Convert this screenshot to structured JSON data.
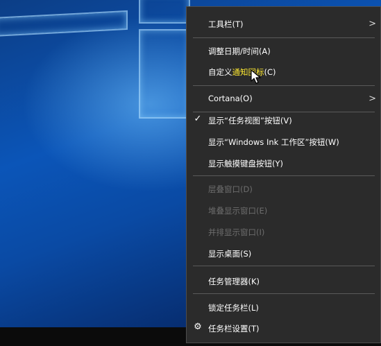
{
  "context_menu": {
    "items": [
      {
        "label": "工具栏(T)",
        "submenu": true
      },
      {
        "label": "调整日期/时间(A)"
      },
      {
        "label_pre": "自定义",
        "label_highlight": "通知图标",
        "label_post": "(C)"
      },
      {
        "label": "Cortana(O)",
        "submenu": true
      },
      {
        "label": "显示“任务视图”按钮(V)",
        "checked": true
      },
      {
        "label": "显示“Windows Ink 工作区”按钮(W)"
      },
      {
        "label": "显示触摸键盘按钮(Y)"
      },
      {
        "label": "层叠窗口(D)",
        "disabled": true
      },
      {
        "label": "堆叠显示窗口(E)",
        "disabled": true
      },
      {
        "label": "并排显示窗口(I)",
        "disabled": true
      },
      {
        "label": "显示桌面(S)"
      },
      {
        "label": "任务管理器(K)"
      },
      {
        "label": "锁定任务栏(L)"
      },
      {
        "label": "任务栏设置(T)",
        "icon": "gear-icon"
      }
    ],
    "submenu_glyph": ">",
    "check_glyph": "✓",
    "gear_glyph": "⚙"
  },
  "colors": {
    "menu_bg": "#2b2b2b",
    "highlight_text": "#ffea32",
    "disabled_text": "#6d6d6d"
  }
}
